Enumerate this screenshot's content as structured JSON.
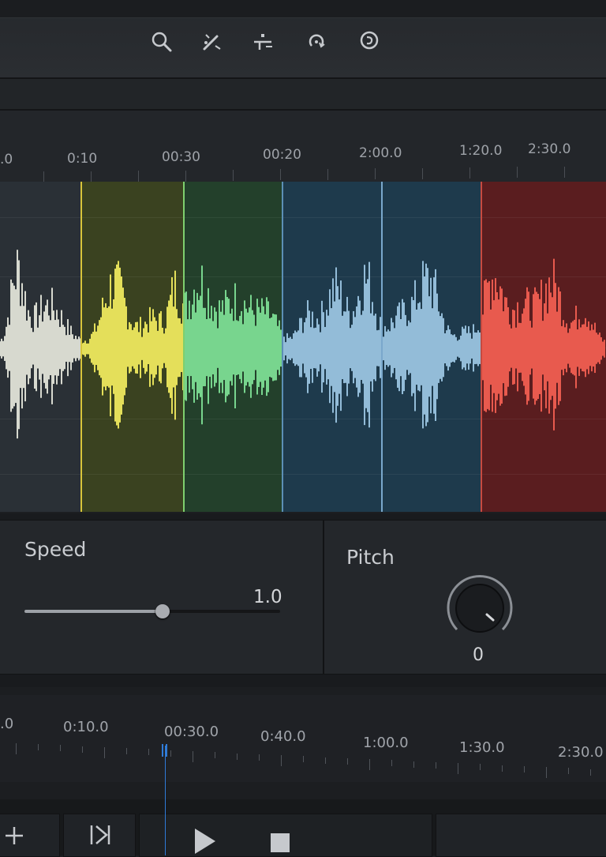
{
  "toolbar": {
    "tools": [
      {
        "icon": "search-icon"
      },
      {
        "icon": "magic-wand-icon"
      },
      {
        "icon": "split-icon"
      },
      {
        "icon": "rotate-icon"
      },
      {
        "icon": "loop-icon"
      }
    ]
  },
  "ruler": {
    "labels": [
      ".0",
      "0:10",
      "00:30",
      "00:20",
      "2:00.0",
      "1:20.0",
      "2:30.0"
    ]
  },
  "waveform": {
    "regions": [
      {
        "color": "#2a3036",
        "wave_color": "#d7d9cf"
      },
      {
        "color": "#3a4220",
        "wave_color": "#e4df5a"
      },
      {
        "color": "#23402b",
        "wave_color": "#78d58e"
      },
      {
        "color": "#1e3a4c",
        "wave_color": "#93bcd8"
      },
      {
        "color": "#5a1d1f",
        "wave_color": "#e85a4e"
      }
    ],
    "marker_colors": [
      "#d8c53a",
      "#7fcf6e",
      "#5c8fb5",
      "#7aa8cc",
      "#c74a40"
    ]
  },
  "controls": {
    "speed": {
      "label": "Speed",
      "value": "1.0",
      "slider_level": 0.54
    },
    "pitch": {
      "label": "Pitch",
      "value": "0"
    }
  },
  "timeline": {
    "labels": [
      ".0",
      "0:10.0",
      "00:30.0",
      "0:40.0",
      "1:00.0",
      "1:30.0",
      "2:30.0"
    ],
    "playhead_color": "#2f7bd8"
  },
  "transport": {
    "buttons": [
      {
        "icon": "add-icon"
      },
      {
        "icon": "skip-to-end-icon"
      },
      {
        "icon": "play-icon"
      },
      {
        "icon": "stop-icon"
      }
    ]
  }
}
